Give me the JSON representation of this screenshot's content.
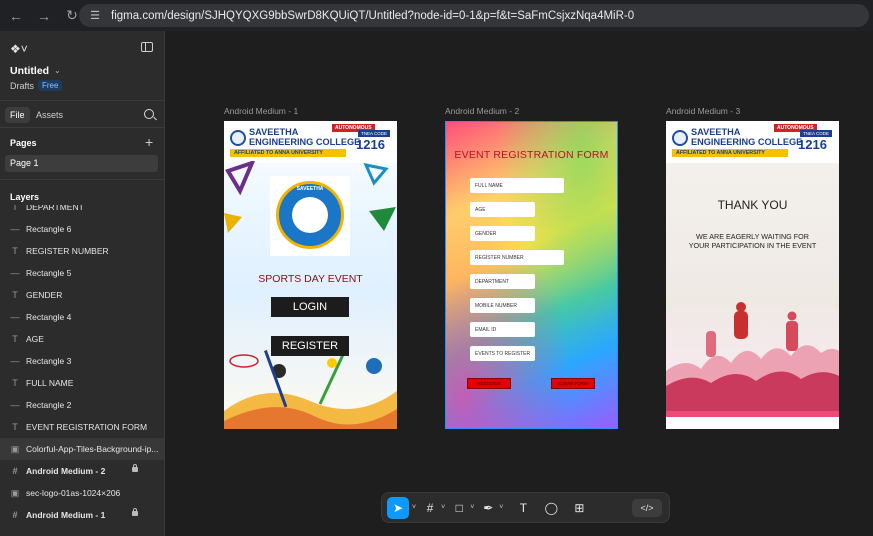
{
  "browser": {
    "url": "figma.com/design/SJHQYQXG9bbSwrD8KQUiQT/Untitled?node-id=0-1&p=f&t=SaFmCsjxzNqa4MiR-0",
    "back_icon": "arrow-left-icon",
    "forward_icon": "arrow-right-icon",
    "reload_icon": "reload-icon",
    "site_info_icon": "tune-icon"
  },
  "left_panel": {
    "file_title": "Untitled",
    "drafts_label": "Drafts",
    "plan_badge": "Free",
    "tabs": [
      {
        "label": "File",
        "active": true
      },
      {
        "label": "Assets",
        "active": false
      }
    ],
    "pages_heading": "Pages",
    "pages": [
      {
        "label": "Page 1",
        "selected": true
      }
    ],
    "layers_heading": "Layers",
    "layers": [
      {
        "label": "DEPARTMENT",
        "icon": "text"
      },
      {
        "label": "Rectangle 6",
        "icon": "rect"
      },
      {
        "label": "REGISTER NUMBER",
        "icon": "text"
      },
      {
        "label": "Rectangle 5",
        "icon": "rect"
      },
      {
        "label": "GENDER",
        "icon": "text"
      },
      {
        "label": "Rectangle 4",
        "icon": "rect"
      },
      {
        "label": "AGE",
        "icon": "text"
      },
      {
        "label": "Rectangle 3",
        "icon": "rect"
      },
      {
        "label": "FULL NAME",
        "icon": "text"
      },
      {
        "label": "Rectangle 2",
        "icon": "rect"
      },
      {
        "label": "EVENT REGISTRATION FORM",
        "icon": "text"
      },
      {
        "label": "Colorful-App-Tiles-Background-ip...",
        "icon": "image",
        "highlight": true
      },
      {
        "label": "Android Medium - 2",
        "icon": "frame",
        "bold": true,
        "locked": true
      },
      {
        "label": "sec-logo-01as-1024×206",
        "icon": "image"
      },
      {
        "label": "Android Medium - 1",
        "icon": "frame",
        "bold": true,
        "locked": true
      }
    ]
  },
  "canvas": {
    "frames": [
      {
        "label": "Android Medium - 1",
        "college_name": "SAVEETHA\nENGINEERING COLLEGE",
        "autonomous": "AUTONOMOUS",
        "affiliation": "AFFILIATED TO ANNA UNIVERSITY",
        "tnea_label": "TNEA CODE",
        "tnea_code": "1216",
        "logo_text": "SAVEETHA",
        "event_title": "SPORTS DAY EVENT",
        "login_label": "LOGIN",
        "register_label": "REGISTER"
      },
      {
        "label": "Android Medium - 2",
        "form_title": "EVENT REGISTRATION FORM",
        "fields": [
          "FULL NAME",
          "AGE",
          "GENDER",
          "REGISTER NUMBER",
          "DEPARTMENT",
          "MOBILE NUMBER",
          "EMAIL ID",
          "EVENTS TO REGISTER"
        ],
        "button_left": "REGISTER",
        "button_right": "CLEAR FORM"
      },
      {
        "label": "Android Medium - 3",
        "college_name": "SAVEETHA\nENGINEERING COLLEGE",
        "autonomous": "AUTONOMOUS",
        "affiliation": "AFFILIATED TO ANNA UNIVERSITY",
        "tnea_label": "TNEA CODE",
        "tnea_code": "1216",
        "thanks": "THANK YOU",
        "waiting_line1": "WE ARE EAGERLY WAITING FOR",
        "waiting_line2": "YOUR PARTICIPATION IN THE EVENT"
      }
    ]
  },
  "toolbar": {
    "tools": [
      "move-icon",
      "frame-icon",
      "rectangle-icon",
      "pen-icon",
      "text-icon",
      "comment-icon",
      "actions-icon"
    ],
    "dev_mode": "</>"
  },
  "colors": {
    "accent": "#0d99ff",
    "canvas_bg": "#1e1e1e",
    "panel_bg": "#2c2c2c"
  }
}
